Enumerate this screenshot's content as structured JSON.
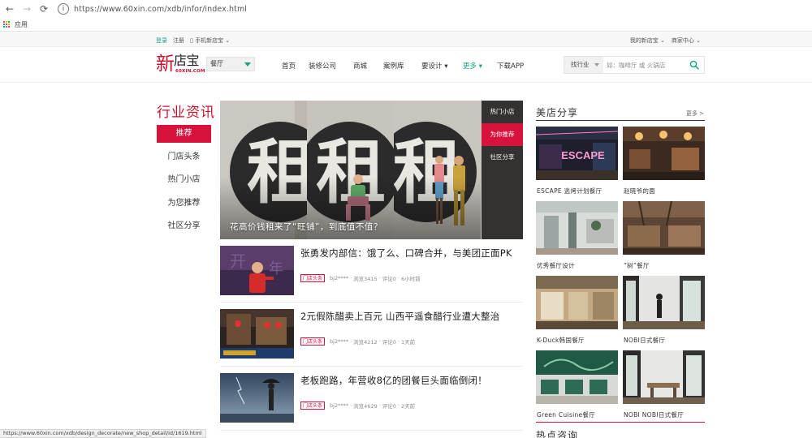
{
  "browser": {
    "url": "https://www.60xin.com/xdb/infor/index.html",
    "bookmark_apps_label": "应用",
    "status_url": "https://www.60xin.com/xdb/design_decorate/new_shop_detail/id/1619.html"
  },
  "topbar": {
    "login": "登录",
    "register": "注册",
    "mobile": "▯ 手机新店宝 ⌄",
    "my_account": "我的新店宝 ⌄",
    "merchant_center": "商家中心 ⌄"
  },
  "header": {
    "logo_xin": "新",
    "logo_rest": "店宝",
    "logo_domain": "60XIN.COM",
    "category_select": "餐厅",
    "nav": [
      {
        "label": "首页"
      },
      {
        "label": "装修公司"
      },
      {
        "label": "商城"
      },
      {
        "label": "案例库"
      },
      {
        "label": "要设计 ▾"
      },
      {
        "label": "更多 ▾"
      },
      {
        "label": "下载APP"
      }
    ],
    "search_category": "找行业",
    "search_placeholder": "如：咖啡厅 或 火锅店"
  },
  "sidebar": {
    "title": "行业资讯",
    "items": [
      {
        "label": "推荐",
        "active": true
      },
      {
        "label": "门店头条"
      },
      {
        "label": "热门小店"
      },
      {
        "label": "为您推荐"
      },
      {
        "label": "社区分享"
      }
    ]
  },
  "hero": {
    "sign_char": "租",
    "caption": "花高价钱租来了“旺铺”，到底值不值？",
    "tabs": [
      {
        "label": "热门小店"
      },
      {
        "label": "为你推荐",
        "active": true
      },
      {
        "label": "社区分享"
      }
    ]
  },
  "articles": [
    {
      "title": "张勇发内部信：饿了么、口碑合并，与美团正面PK",
      "tag": "门店头条",
      "author": "bj2****",
      "views": "浏览3415",
      "comments": "评论0",
      "time": "6小时前"
    },
    {
      "title": "2元假陈醋卖上百元 山西平遥食醋行业遭大整治",
      "tag": "门店头条",
      "author": "bj2****",
      "views": "浏览4212",
      "comments": "评论0",
      "time": "1天前"
    },
    {
      "title": "老板跑路，年营收8亿的团餐巨头面临倒闭！",
      "tag": "门店头条",
      "author": "bj2****",
      "views": "浏览4629",
      "comments": "评论0",
      "time": "2天前"
    }
  ],
  "meta_sep": "·",
  "showcase": {
    "title": "美店分享",
    "more": "更多 >",
    "next_title": "热点咨询",
    "items": [
      {
        "caption": "ESCAPE 逃烤计划餐厅",
        "sign": "ESCAPE"
      },
      {
        "caption": "赵晓爷的面"
      },
      {
        "caption": "优秀餐厅设计"
      },
      {
        "caption": "“树”餐厅"
      },
      {
        "caption": "K-Duck韩国餐厅"
      },
      {
        "caption": "NOBI日式餐厅"
      },
      {
        "caption": "Green Cuisine餐厅"
      },
      {
        "caption": "NOBI NOBI日式餐厅"
      }
    ]
  },
  "colors": {
    "brand_red": "#d6123d",
    "logo_red": "#c7112d",
    "accent_green": "#17a086"
  }
}
